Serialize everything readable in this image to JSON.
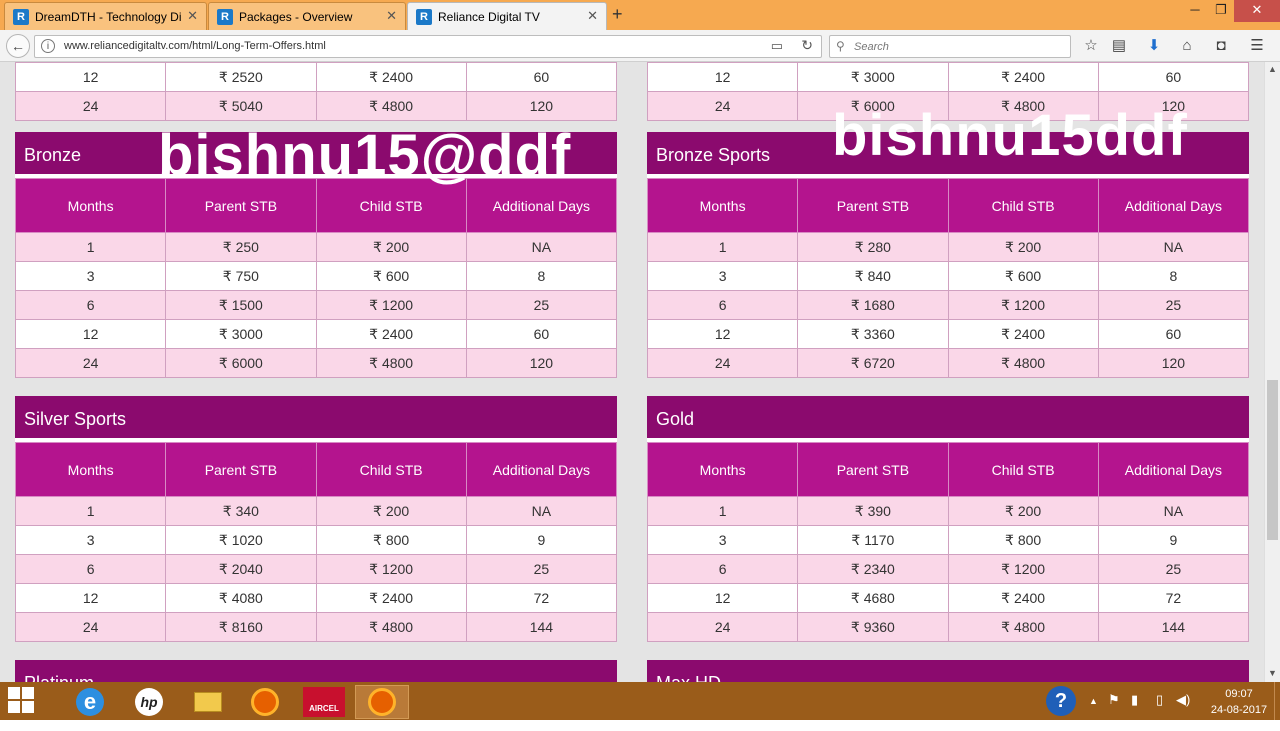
{
  "browser": {
    "tabs": [
      {
        "title": "DreamDTH - Technology Di",
        "icon": "R"
      },
      {
        "title": "Packages - Overview",
        "icon": "R"
      },
      {
        "title": "Reliance Digital TV",
        "icon": "R"
      }
    ],
    "url": "www.reliancedigitaltv.com/html/Long-Term-Offers.html",
    "search_placeholder": "Search"
  },
  "watermarks": [
    "bishnu15@ddf",
    "bishnu15ddf"
  ],
  "column_headers": [
    "Months",
    "Parent STB",
    "Child STB",
    "Additional Days"
  ],
  "top_rows": {
    "left": [
      [
        "12",
        "₹ 2520",
        "₹ 2400",
        "60"
      ],
      [
        "24",
        "₹ 5040",
        "₹ 4800",
        "120"
      ]
    ],
    "right": [
      [
        "12",
        "₹ 3000",
        "₹ 2400",
        "60"
      ],
      [
        "24",
        "₹ 6000",
        "₹ 4800",
        "120"
      ]
    ]
  },
  "packs": [
    {
      "name": "Bronze",
      "rows": [
        [
          "1",
          "₹ 250",
          "₹ 200",
          "NA"
        ],
        [
          "3",
          "₹ 750",
          "₹ 600",
          "8"
        ],
        [
          "6",
          "₹ 1500",
          "₹ 1200",
          "25"
        ],
        [
          "12",
          "₹ 3000",
          "₹ 2400",
          "60"
        ],
        [
          "24",
          "₹ 6000",
          "₹ 4800",
          "120"
        ]
      ]
    },
    {
      "name": "Bronze Sports",
      "rows": [
        [
          "1",
          "₹ 280",
          "₹ 200",
          "NA"
        ],
        [
          "3",
          "₹ 840",
          "₹ 600",
          "8"
        ],
        [
          "6",
          "₹ 1680",
          "₹ 1200",
          "25"
        ],
        [
          "12",
          "₹ 3360",
          "₹ 2400",
          "60"
        ],
        [
          "24",
          "₹ 6720",
          "₹ 4800",
          "120"
        ]
      ]
    },
    {
      "name": "Silver Sports",
      "rows": [
        [
          "1",
          "₹ 340",
          "₹ 200",
          "NA"
        ],
        [
          "3",
          "₹ 1020",
          "₹ 800",
          "9"
        ],
        [
          "6",
          "₹ 2040",
          "₹ 1200",
          "25"
        ],
        [
          "12",
          "₹ 4080",
          "₹ 2400",
          "72"
        ],
        [
          "24",
          "₹ 8160",
          "₹ 4800",
          "144"
        ]
      ]
    },
    {
      "name": "Gold",
      "rows": [
        [
          "1",
          "₹ 390",
          "₹ 200",
          "NA"
        ],
        [
          "3",
          "₹ 1170",
          "₹ 800",
          "9"
        ],
        [
          "6",
          "₹ 2340",
          "₹ 1200",
          "25"
        ],
        [
          "12",
          "₹ 4680",
          "₹ 2400",
          "72"
        ],
        [
          "24",
          "₹ 9360",
          "₹ 4800",
          "144"
        ]
      ]
    },
    {
      "name": "Platinum",
      "rows": []
    },
    {
      "name": "Max HD",
      "rows": []
    }
  ],
  "taskbar": {
    "apps": [
      "internet-explorer",
      "hp",
      "file-explorer",
      "firefox",
      "aircel",
      "firefox-active"
    ],
    "aircel_label": "AIRCEL",
    "time": "09:07",
    "date": "24-08-2017"
  },
  "colors": {
    "header": "#8b0a6e",
    "thead": "#b4148e",
    "row_pink": "#fad7e8"
  }
}
